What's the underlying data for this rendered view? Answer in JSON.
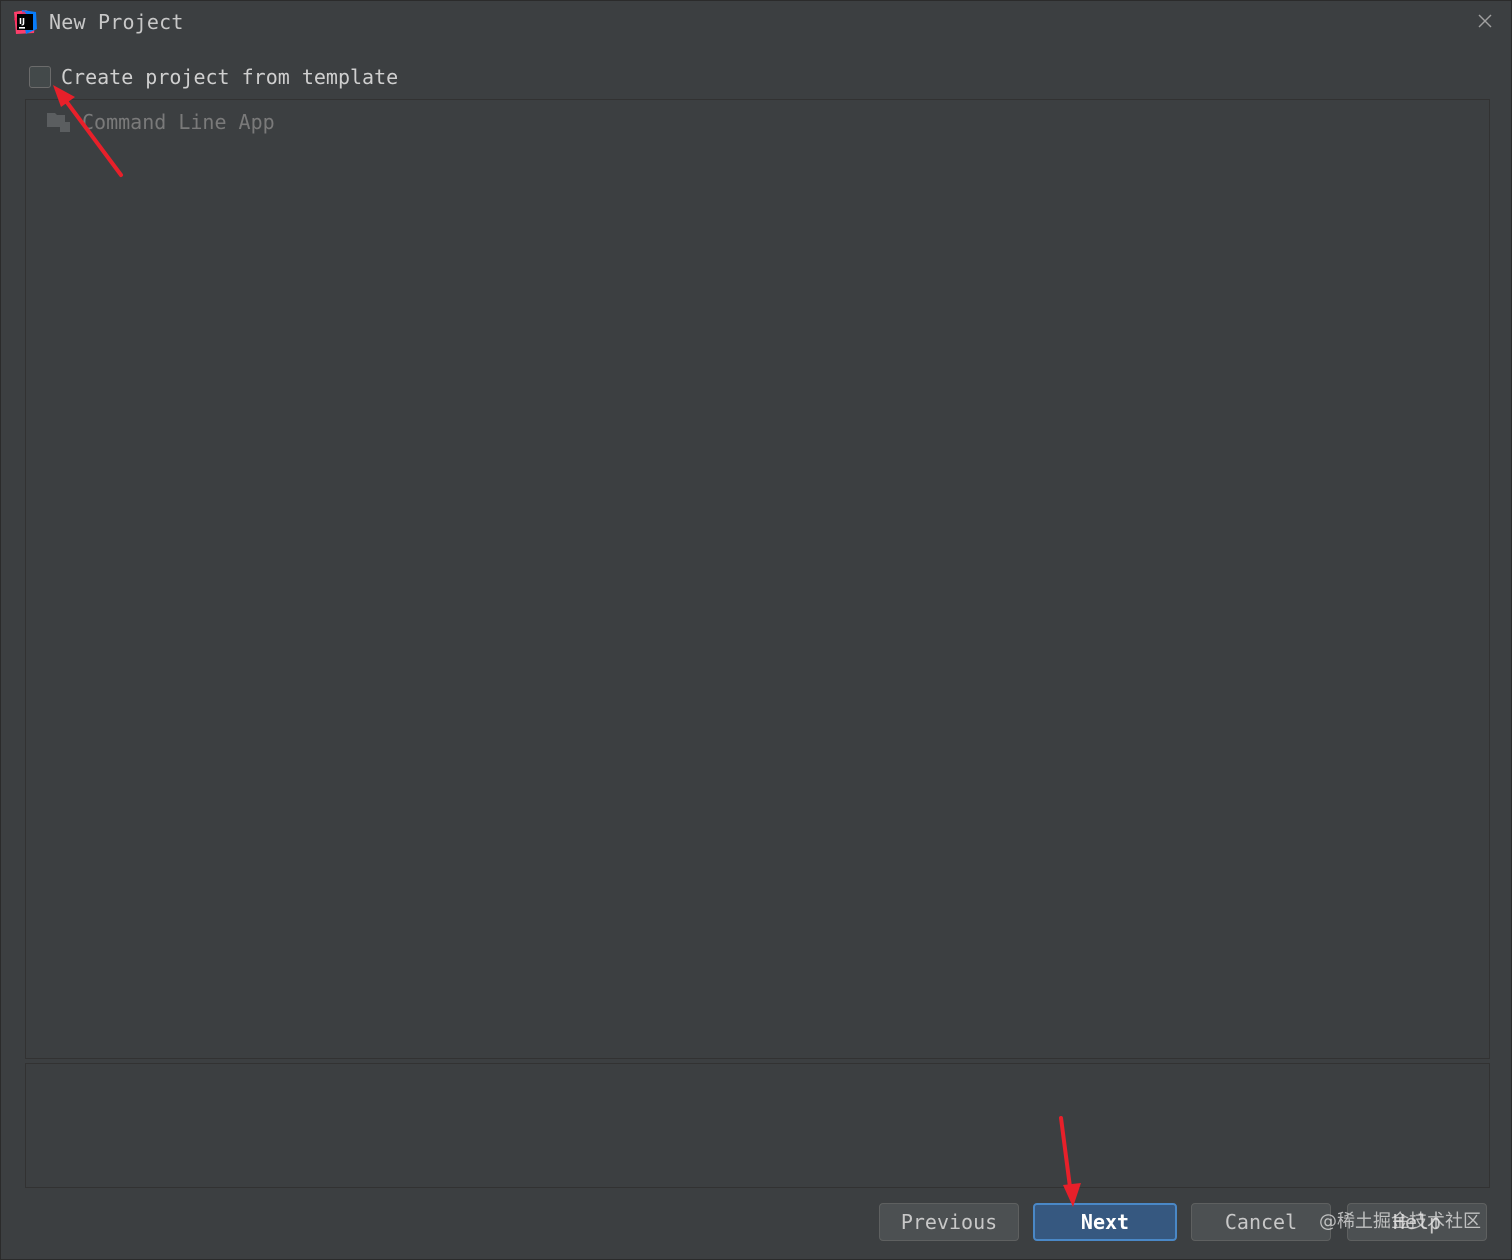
{
  "window": {
    "title": "New Project",
    "icon": "intellij-idea-icon",
    "close_icon": "close-icon"
  },
  "template_option": {
    "label": "Create project from template",
    "checked": false
  },
  "templates": {
    "items": [
      {
        "label": "Command Line App",
        "icon": "folder-icon",
        "enabled": false
      }
    ]
  },
  "buttons": {
    "previous": "Previous",
    "next": "Next",
    "cancel": "Cancel",
    "help": "Help"
  },
  "watermark": "@稀土掘金技术社区",
  "colors": {
    "background": "#3c3f41",
    "primary_button": "#365880",
    "primary_button_border": "#4a88c7",
    "annotation_arrow": "#e8202a"
  }
}
